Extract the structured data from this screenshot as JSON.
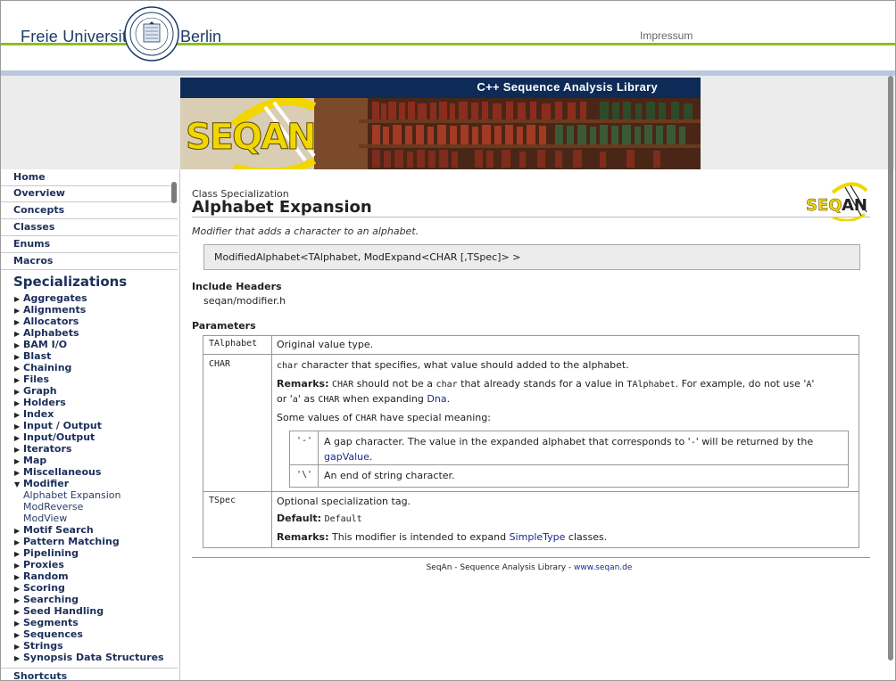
{
  "header": {
    "university_left": "Freie Universität",
    "university_right": "Berlin",
    "impressum": "Impressum"
  },
  "banner": {
    "title": "C++ Sequence Analysis Library",
    "logo_text": "SEQAN"
  },
  "sidebar": {
    "main_items": [
      "Home",
      "Overview",
      "Concepts",
      "Classes",
      "Enums",
      "Macros"
    ],
    "specializations_heading": "Specializations",
    "categories": [
      "Aggregates",
      "Alignments",
      "Allocators",
      "Alphabets",
      "BAM I/O",
      "Blast",
      "Chaining",
      "Files",
      "Graph",
      "Holders",
      "Index",
      "Input / Output",
      "Input/Output",
      "Iterators",
      "Map",
      "Miscellaneous"
    ],
    "expanded_category": "Modifier",
    "sub_items": [
      "Alphabet Expansion",
      "ModReverse",
      "ModView"
    ],
    "categories_after": [
      "Motif Search",
      "Pattern Matching",
      "Pipelining",
      "Proxies",
      "Random",
      "Scoring",
      "Searching",
      "Seed Handling",
      "Segments",
      "Sequences",
      "Strings",
      "Synopsis Data Structures"
    ],
    "shortcuts": "Shortcuts"
  },
  "main": {
    "kind": "Class Specialization",
    "title": "Alphabet Expansion",
    "summary": "Modifier that adds a character to an alphabet.",
    "signature": "ModifiedAlphabet<TAlphabet, ModExpand<CHAR [,TSpec]> >",
    "include_heading": "Include Headers",
    "include_file": "seqan/modifier.h",
    "params_heading": "Parameters",
    "params": {
      "talphabet": {
        "name": "TAlphabet",
        "desc": "Original value type."
      },
      "char": {
        "name": "CHAR",
        "line1_code": "char",
        "line1_rest": " character that specifies, what value should added to the alphabet.",
        "remarks_label": "Remarks:",
        "remarks_p1": " ",
        "remarks_code1": "CHAR",
        "remarks_p2": " should not be a ",
        "remarks_code2": "char",
        "remarks_p3": " that already stands for a value in ",
        "remarks_code3": "TAlphabet",
        "remarks_p4": ". For example, do not use '",
        "remarks_code4": "A",
        "remarks_p5": "'",
        "remarks_l2_p1": "or '",
        "remarks_l2_code1": "a",
        "remarks_l2_p2": "' as ",
        "remarks_l2_code2": "CHAR",
        "remarks_l2_p3": " when expanding ",
        "remarks_l2_link": "Dna",
        "remarks_l2_p4": ".",
        "special_p1": "Some values of ",
        "special_code": "CHAR",
        "special_p2": " have special meaning:",
        "special": [
          {
            "name": "'-'",
            "text_l1_p1": "A gap character. The value in the expanded alphabet that corresponds to '",
            "text_l1_code": "-",
            "text_l1_p2": "' will be returned by the",
            "text_l2_link": "gapValue",
            "text_l2_p": "."
          },
          {
            "name": "'\\'",
            "text": "An end of string character."
          }
        ]
      },
      "tspec": {
        "name": "TSpec",
        "desc": "Optional specialization tag.",
        "default_label": "Default:",
        "default_value": "Default",
        "remarks_label": "Remarks:",
        "remarks_p1": " This modifier is intended to expand ",
        "remarks_link": "SimpleType",
        "remarks_p2": " classes."
      }
    },
    "footer_text": "SeqAn - Sequence Analysis Library - ",
    "footer_link": "www.seqan.de"
  },
  "colors": {
    "green_line": "#8cbf1f",
    "navy": "#0e2a57",
    "link": "#1a2b8a",
    "logo_yellow": "#f2d600"
  }
}
